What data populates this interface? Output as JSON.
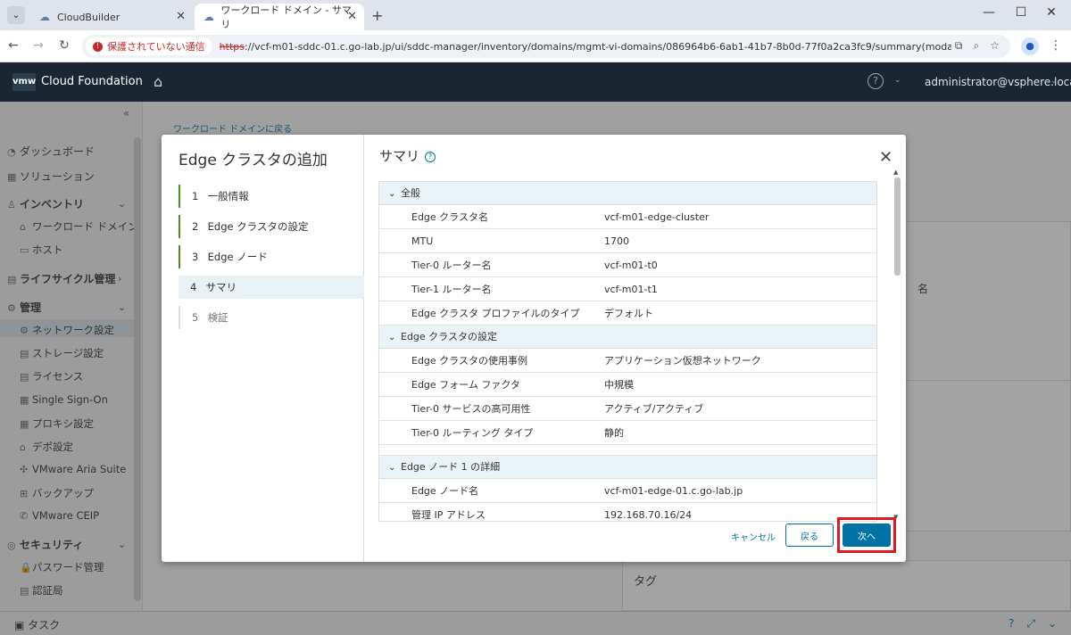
{
  "browser": {
    "tabs": [
      {
        "title": "CloudBuilder",
        "active": false
      },
      {
        "title": "ワークロード ドメイン - サマリ",
        "active": true
      }
    ],
    "security_label": "保護されていない通信",
    "url_scheme": "https",
    "url_rest": "://vcf-m01-sddc-01.c.go-lab.jp/ui/sddc-manager/inventory/domains/mgmt-vi-domains/086964b6-6ab1-41b7-8b0d-77f0a2ca3fc9/summary(modal:add-edge-c..."
  },
  "app": {
    "logo": "vmw",
    "product": "Cloud Foundation",
    "user": "administrator@vsphere.local"
  },
  "sidebar": {
    "items": [
      {
        "label": "ダッシュボード"
      },
      {
        "label": "ソリューション"
      },
      {
        "label": "インベントリ"
      },
      {
        "label": "ワークロード ドメイン"
      },
      {
        "label": "ホスト"
      },
      {
        "label": "ライフサイクル管理"
      },
      {
        "label": "管理"
      },
      {
        "label": "ネットワーク設定"
      },
      {
        "label": "ストレージ設定"
      },
      {
        "label": "ライセンス"
      },
      {
        "label": "Single Sign-On"
      },
      {
        "label": "プロキシ設定"
      },
      {
        "label": "デポ設定"
      },
      {
        "label": "VMware Aria Suite"
      },
      {
        "label": "バックアップ"
      },
      {
        "label": "VMware CEIP"
      },
      {
        "label": "セキュリティ"
      },
      {
        "label": "パスワード管理"
      },
      {
        "label": "認証局"
      }
    ]
  },
  "background": {
    "breadcrumb": "ワークロード ドメインに戻る",
    "tag_title": "タグ",
    "partial_name": "名"
  },
  "statusbar": {
    "task": "タスク"
  },
  "modal": {
    "wizard_title": "Edge クラスタの追加",
    "steps": [
      {
        "num": "1",
        "label": "一般情報"
      },
      {
        "num": "2",
        "label": "Edge クラスタの設定"
      },
      {
        "num": "3",
        "label": "Edge ノード"
      },
      {
        "num": "4",
        "label": "サマリ"
      },
      {
        "num": "5",
        "label": "検証"
      }
    ],
    "summary_title": "サマリ",
    "sections": [
      {
        "title": "全般",
        "rows": [
          {
            "key": "Edge クラスタ名",
            "value": "vcf-m01-edge-cluster"
          },
          {
            "key": "MTU",
            "value": "1700"
          },
          {
            "key": "Tier-0 ルーター名",
            "value": "vcf-m01-t0"
          },
          {
            "key": "Tier-1 ルーター名",
            "value": "vcf-m01-t1"
          },
          {
            "key": "Edge クラスタ プロファイルのタイプ",
            "value": "デフォルト"
          }
        ]
      },
      {
        "title": "Edge クラスタの設定",
        "rows": [
          {
            "key": "Edge クラスタの使用事例",
            "value": "アプリケーション仮想ネットワーク"
          },
          {
            "key": "Edge フォーム ファクタ",
            "value": "中規模"
          },
          {
            "key": "Tier-0 サービスの高可用性",
            "value": "アクティブ/アクティブ"
          },
          {
            "key": "Tier-0 ルーティング タイプ",
            "value": "静的"
          }
        ]
      },
      {
        "title": "Edge ノード 1 の詳細",
        "rows": [
          {
            "key": "Edge ノード名",
            "value": "vcf-m01-edge-01.c.go-lab.jp"
          },
          {
            "key": "管理 IP アドレス",
            "value": "192.168.70.16/24"
          }
        ]
      }
    ],
    "buttons": {
      "cancel": "キャンセル",
      "back": "戻る",
      "next": "次へ"
    }
  },
  "colors": {
    "accent": "#0072a3",
    "header": "#1a2733",
    "step_done": "#4a8c2a",
    "highlight": "#e01a22"
  }
}
